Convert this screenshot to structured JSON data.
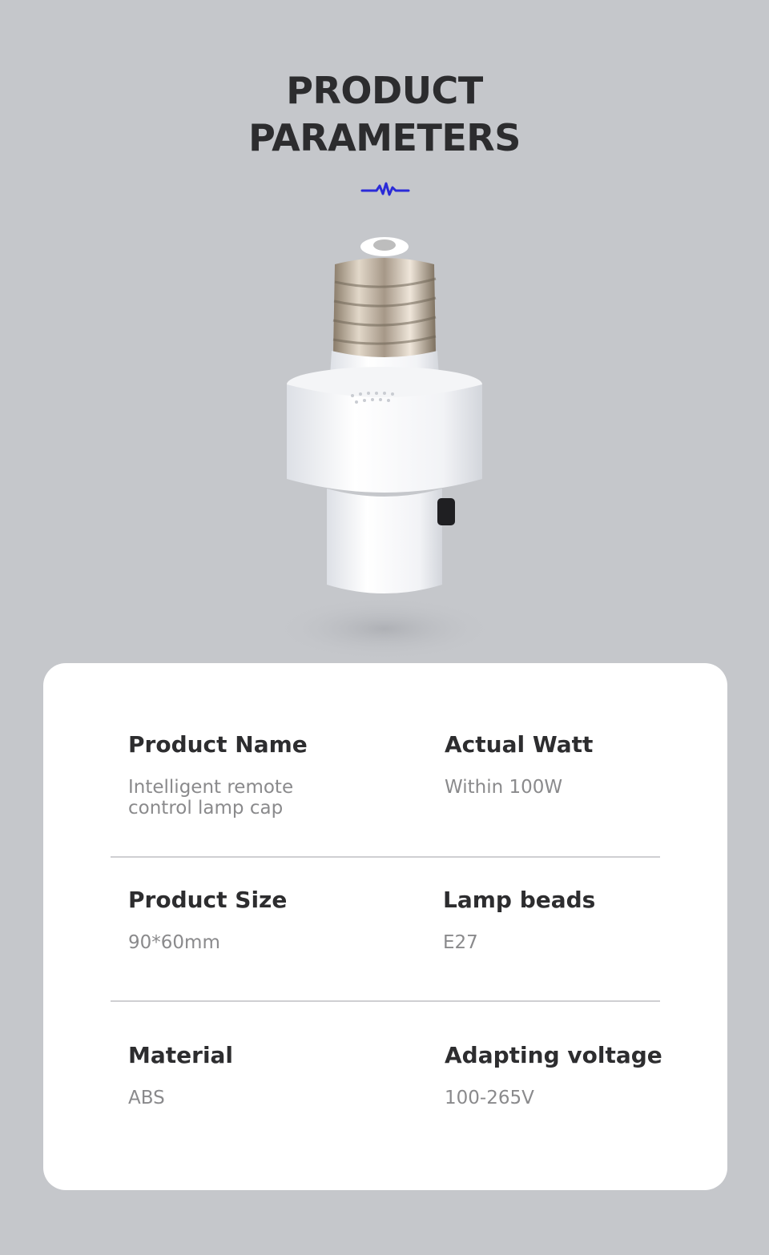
{
  "header": {
    "title_line1": "PRODUCT",
    "title_line2": "PARAMETERS",
    "accent_color": "#2b2bd8",
    "decoration_icon": "squiggle-wave-icon"
  },
  "product_image": {
    "alt": "lamp-socket-image"
  },
  "params": [
    {
      "label": "Product Name",
      "value": "Intelligent remote control lamp cap"
    },
    {
      "label": "Actual Watt",
      "value": "Within 100W"
    },
    {
      "label": "Product Size",
      "value": "90*60mm"
    },
    {
      "label": "Lamp beads",
      "value": "E27"
    },
    {
      "label": "Material",
      "value": "ABS"
    },
    {
      "label": "Adapting voltage",
      "value": "100-265V"
    }
  ]
}
